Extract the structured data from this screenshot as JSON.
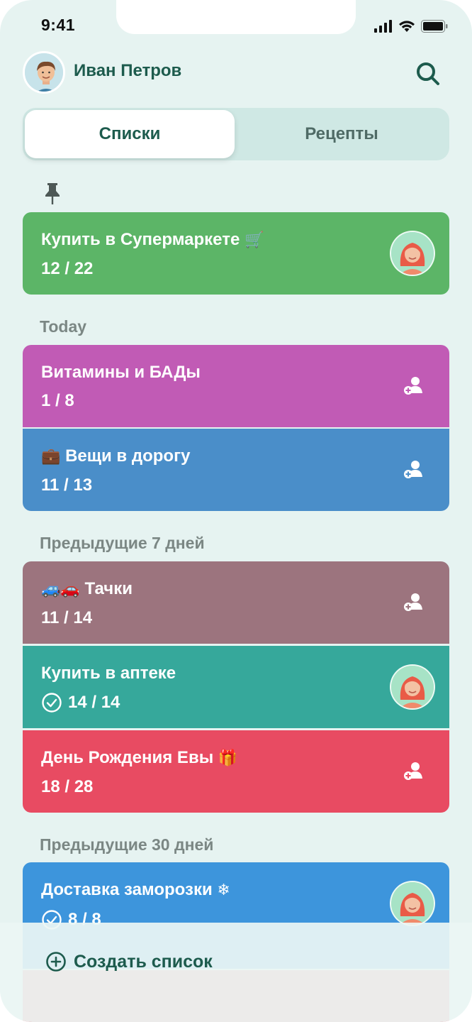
{
  "status_bar": {
    "time": "9:41"
  },
  "header": {
    "user_name": "Иван Петров"
  },
  "tabs": [
    {
      "label": "Списки",
      "active": true
    },
    {
      "label": "Рецепты",
      "active": false
    }
  ],
  "pinned": [
    {
      "title": "Купить в Супермаркете",
      "emoji": "🛒",
      "count": "12 / 22",
      "color": "#5cb567",
      "action": "avatar"
    }
  ],
  "sections": [
    {
      "title": "Today",
      "lists": [
        {
          "title": "Витамины и БАДы",
          "emoji": "",
          "count": "1 / 8",
          "color": "#c15bb5",
          "action": "add-user"
        },
        {
          "title": "Вещи в дорогу",
          "emoji": "💼",
          "count": "11 / 13",
          "color": "#4a8ec9",
          "action": "add-user"
        }
      ]
    },
    {
      "title": "Предыдущие 7 дней",
      "lists": [
        {
          "title": "Тачки",
          "emoji": "🚙🚗",
          "count": "11 / 14",
          "color": "#9c747e",
          "action": "add-user"
        },
        {
          "title": "Купить в аптеке",
          "emoji": "",
          "count": "14 / 14",
          "completed": true,
          "color": "#36a89b",
          "action": "avatar"
        },
        {
          "title": "День Рождения Евы",
          "emoji": "🎁",
          "count": "18 / 28",
          "color": "#e84b62",
          "action": "add-user"
        }
      ]
    },
    {
      "title": "Предыдущие 30 дней",
      "lists": [
        {
          "title": "Доставка заморозки",
          "emoji": "❄",
          "count": "8 / 8",
          "completed": true,
          "color": "#3d95dc",
          "action": "avatar"
        }
      ]
    }
  ],
  "create_button": {
    "label": "Создать список"
  }
}
